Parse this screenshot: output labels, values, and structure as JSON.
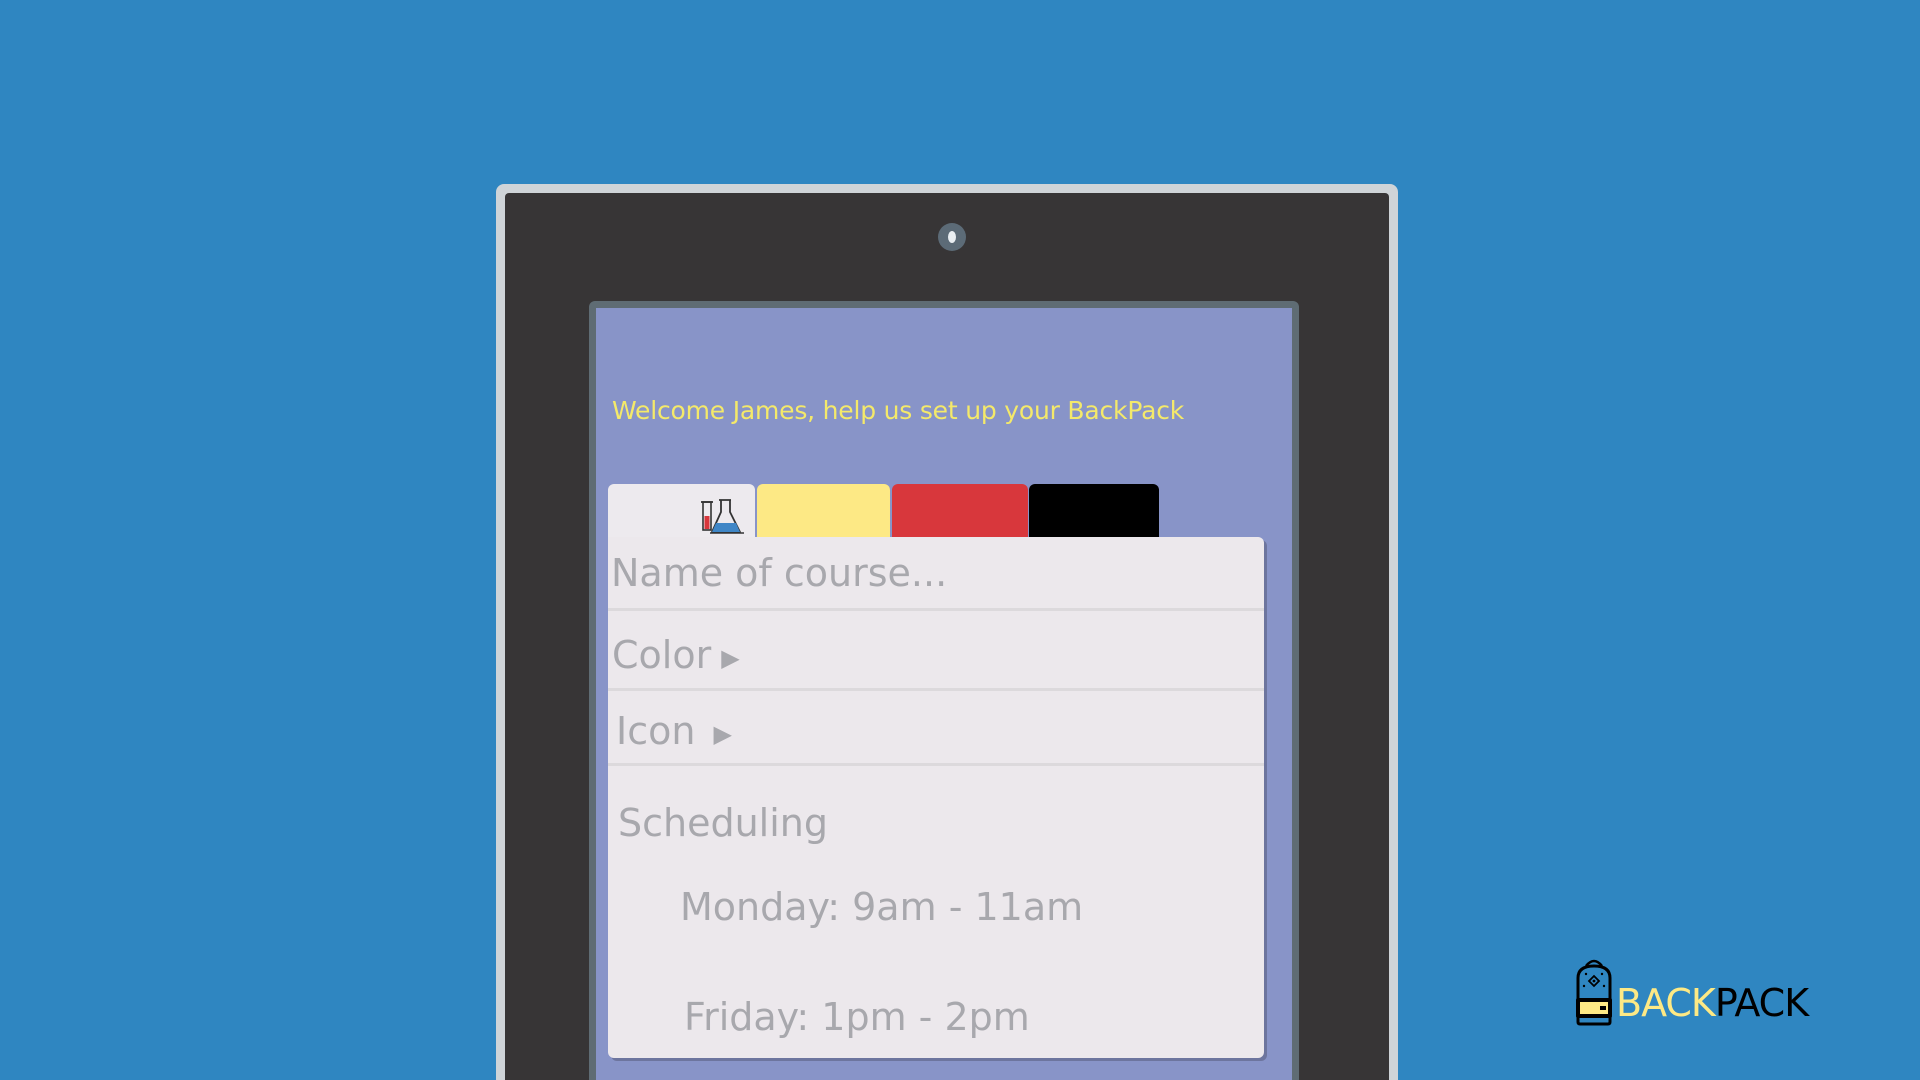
{
  "screen": {
    "welcome_text": "Welcome James, help us set up your BackPack"
  },
  "tabs": [
    {
      "icon": "flask-icon",
      "color": "#edeaee"
    },
    {
      "color": "#fde985"
    },
    {
      "color": "#d8373c"
    },
    {
      "color": "#000000"
    }
  ],
  "form": {
    "name_placeholder": "Name of course...",
    "color_label": "Color",
    "icon_label": "Icon",
    "arrow_glyph": "▶",
    "scheduling_title": "Scheduling",
    "schedule": [
      "Monday: 9am - 11am",
      "Friday: 1pm - 2pm"
    ]
  },
  "brand": {
    "part1": "BACK",
    "part2": "PACK"
  },
  "colors": {
    "background": "#2f86c1",
    "screen": "#8894c8",
    "welcome": "#f4e96a",
    "card": "#ece8ec"
  }
}
